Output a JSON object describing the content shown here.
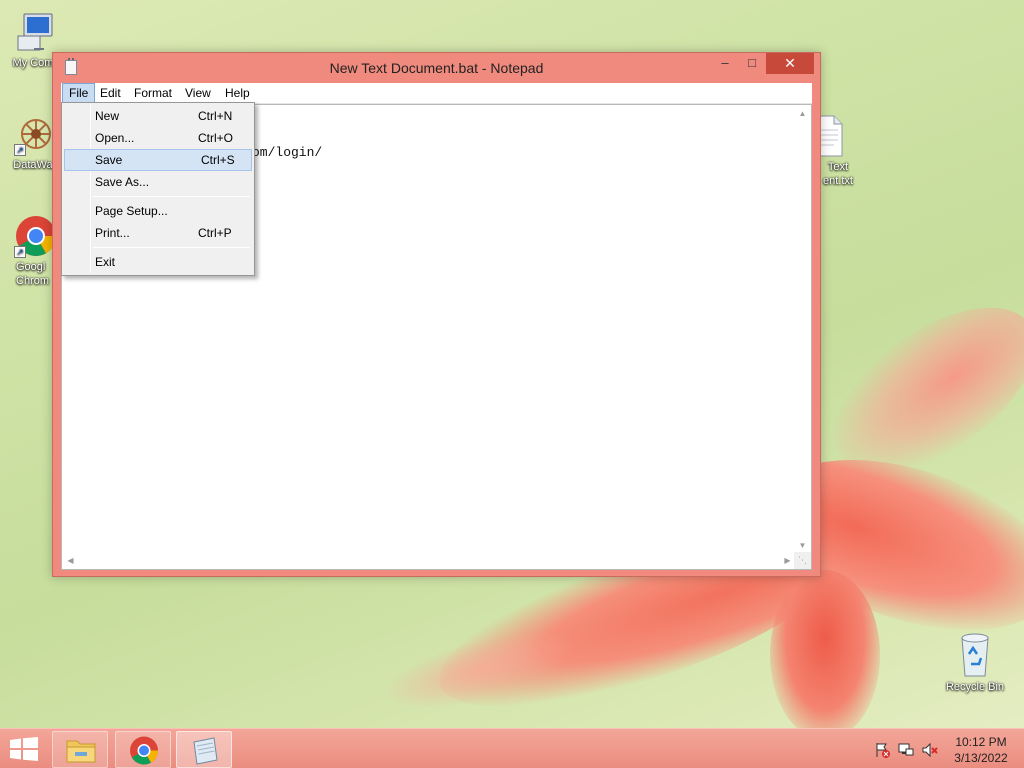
{
  "window": {
    "title": "New Text Document.bat - Notepad",
    "controls": {
      "minimize": "–",
      "maximize": "□",
      "close": "✕"
    }
  },
  "menubar": {
    "items": [
      "File",
      "Edit",
      "Format",
      "View",
      "Help"
    ],
    "active": "File"
  },
  "editor": {
    "visible_text": "om/login/"
  },
  "file_menu": {
    "items": [
      {
        "label": "New",
        "shortcut": "Ctrl+N"
      },
      {
        "label": "Open...",
        "shortcut": "Ctrl+O"
      },
      {
        "label": "Save",
        "shortcut": "Ctrl+S",
        "highlighted": true
      },
      {
        "label": "Save As...",
        "shortcut": ""
      },
      {
        "label": "Page Setup...",
        "shortcut": ""
      },
      {
        "label": "Print...",
        "shortcut": "Ctrl+P"
      },
      {
        "label": "Exit",
        "shortcut": ""
      }
    ]
  },
  "desktop": {
    "icons": [
      {
        "name": "my-computer",
        "label": "My Comp"
      },
      {
        "name": "datawag",
        "label": "DataWag"
      },
      {
        "name": "google-chrome",
        "label": "Googl Chrom"
      },
      {
        "name": "text-document",
        "label": "Text ent.txt"
      },
      {
        "name": "recycle-bin",
        "label": "Recycle Bin"
      }
    ]
  },
  "taskbar": {
    "pinned": [
      "file-explorer",
      "google-chrome",
      "notepad"
    ],
    "active": "notepad",
    "tray": [
      "action-center-flag",
      "network",
      "volume-muted"
    ],
    "clock": {
      "time": "10:12 PM",
      "date": "3/13/2022"
    }
  },
  "colors": {
    "window_frame": "#f08a7e",
    "close_button": "#c7493a",
    "menu_highlight": "#d5e4f5",
    "taskbar": "#ea8d80"
  }
}
